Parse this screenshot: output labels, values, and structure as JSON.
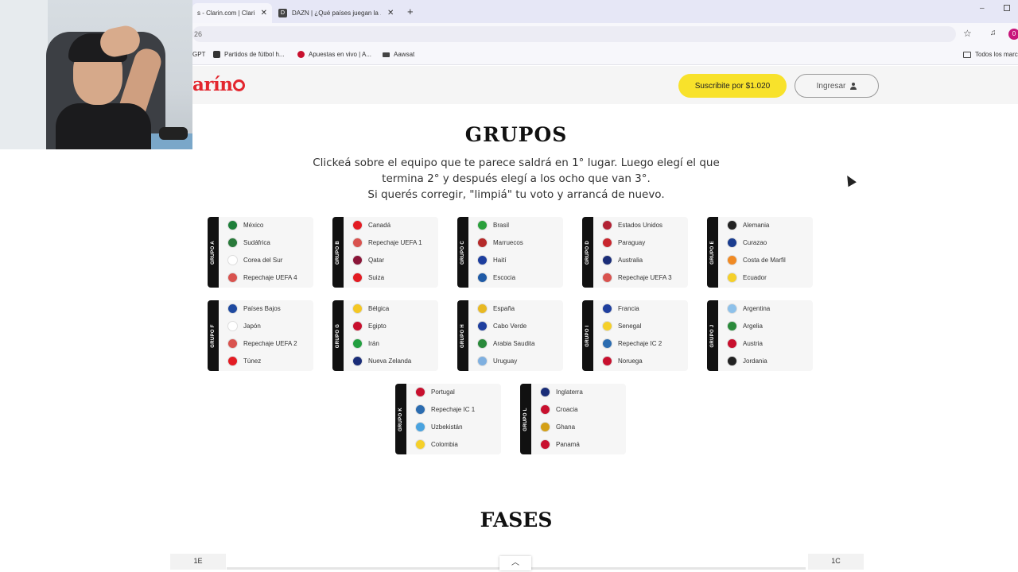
{
  "browser": {
    "tabs": [
      {
        "title": "s - Clarin.com | Clarín",
        "active": true
      },
      {
        "title": "DAZN | ¿Qué países juegan la ...",
        "active": false
      }
    ],
    "new_tab": "+",
    "window_minimize": "–",
    "address": "26",
    "bookmarks": [
      {
        "label": "GPT",
        "icon": "chat-icon"
      },
      {
        "label": "Partidos de fútbol h...",
        "icon": "football-site-icon"
      },
      {
        "label": "Apuestas en vivo | A...",
        "icon": "betting-site-icon"
      },
      {
        "label": "Aawsat",
        "icon": "news-site-icon"
      },
      {
        "label": "Todos los marc",
        "icon": "folder-icon"
      }
    ],
    "profile_initial": "0"
  },
  "header": {
    "logo": "arín",
    "subscribe_label": "Suscribite por $1.020",
    "login_label": "Ingresar",
    "accent_color": "#e3262e",
    "subscribe_color": "#f8e22b"
  },
  "grupos": {
    "title": "GRUPOS",
    "instructions": [
      "Clickeá sobre el equipo que te parece saldrá en 1° lugar. Luego elegí el que",
      "termina 2° y después elegí a los ocho que van 3°.",
      "Si querés corregir, \"limpiá\" tu voto y arrancá de nuevo."
    ],
    "groups": [
      {
        "label": "GRUPO A",
        "teams": [
          {
            "name": "México",
            "flag": "#1e7f3a"
          },
          {
            "name": "Sudáfrica",
            "flag": "#2a7a3b"
          },
          {
            "name": "Corea del Sur",
            "flag": "#ffffff"
          },
          {
            "name": "Repechaje UEFA 4",
            "flag": "#d9534f"
          }
        ]
      },
      {
        "label": "GRUPO B",
        "teams": [
          {
            "name": "Canadá",
            "flag": "#e31c23"
          },
          {
            "name": "Repechaje UEFA 1",
            "flag": "#d9534f"
          },
          {
            "name": "Qatar",
            "flag": "#8a1538"
          },
          {
            "name": "Suiza",
            "flag": "#e31c23"
          }
        ]
      },
      {
        "label": "GRUPO C",
        "teams": [
          {
            "name": "Brasil",
            "flag": "#2ba03c"
          },
          {
            "name": "Marruecos",
            "flag": "#b52a2a"
          },
          {
            "name": "Haití",
            "flag": "#1d3e9e"
          },
          {
            "name": "Escocia",
            "flag": "#1f5aa6"
          }
        ]
      },
      {
        "label": "GRUPO D",
        "teams": [
          {
            "name": "Estados Unidos",
            "flag": "#b22234"
          },
          {
            "name": "Paraguay",
            "flag": "#c8262e"
          },
          {
            "name": "Australia",
            "flag": "#1a2d78"
          },
          {
            "name": "Repechaje UEFA 3",
            "flag": "#d9534f"
          }
        ]
      },
      {
        "label": "GRUPO E",
        "teams": [
          {
            "name": "Alemania",
            "flag": "#222222"
          },
          {
            "name": "Curazao",
            "flag": "#1b3d8f"
          },
          {
            "name": "Costa de Marfil",
            "flag": "#f08a24"
          },
          {
            "name": "Ecuador",
            "flag": "#f5d02a"
          }
        ]
      },
      {
        "label": "GRUPO F",
        "teams": [
          {
            "name": "Países Bajos",
            "flag": "#1f4aa0"
          },
          {
            "name": "Japón",
            "flag": "#ffffff"
          },
          {
            "name": "Repechaje UEFA 2",
            "flag": "#d9534f"
          },
          {
            "name": "Túnez",
            "flag": "#e31c23"
          }
        ]
      },
      {
        "label": "GRUPO G",
        "teams": [
          {
            "name": "Bélgica",
            "flag": "#f4c724"
          },
          {
            "name": "Egipto",
            "flag": "#c8102e"
          },
          {
            "name": "Irán",
            "flag": "#239f40"
          },
          {
            "name": "Nueva Zelanda",
            "flag": "#1a2d78"
          }
        ]
      },
      {
        "label": "GRUPO H",
        "teams": [
          {
            "name": "España",
            "flag": "#e8b923"
          },
          {
            "name": "Cabo Verde",
            "flag": "#1f3f9e"
          },
          {
            "name": "Arabia Saudita",
            "flag": "#2a8a3b"
          },
          {
            "name": "Uruguay",
            "flag": "#7fb0e0"
          }
        ]
      },
      {
        "label": "GRUPO I",
        "teams": [
          {
            "name": "Francia",
            "flag": "#1f3f9e"
          },
          {
            "name": "Senegal",
            "flag": "#f5d02a"
          },
          {
            "name": "Repechaje IC 2",
            "flag": "#2b6cb0"
          },
          {
            "name": "Noruega",
            "flag": "#c8102e"
          }
        ]
      },
      {
        "label": "GRUPO J",
        "teams": [
          {
            "name": "Argentina",
            "flag": "#8ec1ea"
          },
          {
            "name": "Argelia",
            "flag": "#2a8a3b"
          },
          {
            "name": "Austria",
            "flag": "#c8102e"
          },
          {
            "name": "Jordania",
            "flag": "#222222"
          }
        ]
      },
      {
        "label": "GRUPO K",
        "teams": [
          {
            "name": "Portugal",
            "flag": "#c8102e"
          },
          {
            "name": "Repechaje IC 1",
            "flag": "#2b6cb0"
          },
          {
            "name": "Uzbekistán",
            "flag": "#4aa3df"
          },
          {
            "name": "Colombia",
            "flag": "#f5d02a"
          }
        ]
      },
      {
        "label": "GRUPO L",
        "teams": [
          {
            "name": "Inglaterra",
            "flag": "#1a2d78"
          },
          {
            "name": "Croacia",
            "flag": "#c8102e"
          },
          {
            "name": "Ghana",
            "flag": "#d4a017"
          },
          {
            "name": "Panamá",
            "flag": "#c8102e"
          }
        ]
      }
    ]
  },
  "fases": {
    "title": "FASES",
    "left_label": "1E",
    "right_label": "1C",
    "scroll_icon": "chevron-up-icon"
  }
}
